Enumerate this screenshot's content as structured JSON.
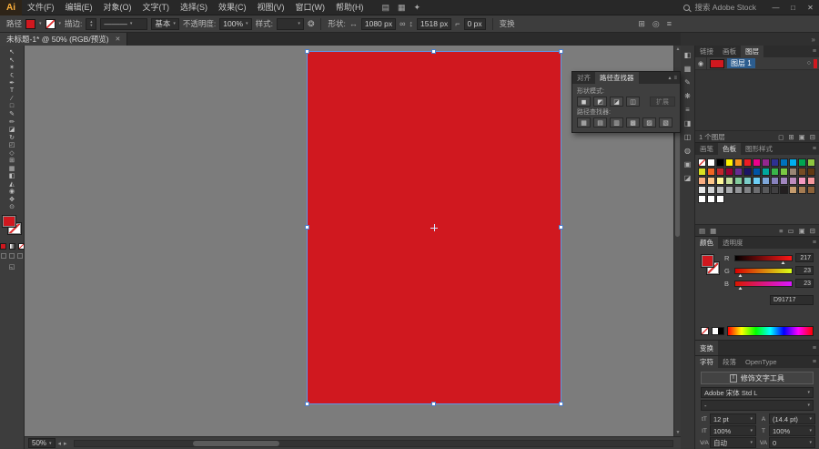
{
  "window": {
    "minimize": "—",
    "maximize": "□",
    "close": "✕"
  },
  "menubar": {
    "logo": "Ai",
    "items": [
      "文件(F)",
      "编辑(E)",
      "对象(O)",
      "文字(T)",
      "选择(S)",
      "效果(C)",
      "视图(V)",
      "窗口(W)",
      "帮助(H)"
    ],
    "app_icons": [
      {
        "name": "bridge-icon",
        "glyph": "▤"
      },
      {
        "name": "arrange-documents-icon",
        "glyph": "▦"
      },
      {
        "name": "workspace-switcher-icon",
        "glyph": "✦"
      }
    ],
    "search_label": "搜索 Adobe Stock"
  },
  "controlbar": {
    "object_label": "路径",
    "fill_color": "#d0181f",
    "stroke_label": "描边:",
    "profile_value": "———",
    "brush_value": "基本",
    "opacity_label": "不透明度:",
    "opacity_value": "100%",
    "style_label": "样式:",
    "recolor_glyph": "❂",
    "shape_label": "形状:",
    "w_value": "1080 px",
    "link_glyph": "∞",
    "h_value": "1518 px",
    "corner_value": "0 px",
    "transform_label": "变换",
    "right_icons": [
      {
        "name": "align-objects-icon",
        "glyph": "⊞"
      },
      {
        "name": "isolate-icon",
        "glyph": "◎"
      },
      {
        "name": "control-panel-menu-icon",
        "glyph": "≡"
      }
    ]
  },
  "doc_tab": {
    "title": "未标题-1* @ 50% (RGB/预览)",
    "close_glyph": "✕"
  },
  "toolbar": {
    "fill_color": "#d0181f",
    "tools": [
      {
        "name": "selection-tool",
        "glyph": "↖"
      },
      {
        "name": "direct-selection-tool",
        "glyph": "↖"
      },
      {
        "name": "magic-wand-tool",
        "glyph": "✶"
      },
      {
        "name": "lasso-tool",
        "glyph": "ς"
      },
      {
        "name": "pen-tool",
        "glyph": "✒"
      },
      {
        "name": "type-tool",
        "glyph": "T"
      },
      {
        "name": "line-segment-tool",
        "glyph": "∕"
      },
      {
        "name": "rectangle-tool",
        "glyph": "□"
      },
      {
        "name": "paintbrush-tool",
        "glyph": "✎"
      },
      {
        "name": "pencil-tool",
        "glyph": "✏"
      },
      {
        "name": "eraser-tool",
        "glyph": "◪"
      },
      {
        "name": "rotate-tool",
        "glyph": "↻"
      },
      {
        "name": "scale-tool",
        "glyph": "◰"
      },
      {
        "name": "width-tool",
        "glyph": "◇"
      },
      {
        "name": "shape-builder-tool",
        "glyph": "⊞"
      },
      {
        "name": "mesh-tool",
        "glyph": "▦"
      },
      {
        "name": "gradient-tool",
        "glyph": "◧"
      },
      {
        "name": "eyedropper-tool",
        "glyph": "◭"
      },
      {
        "name": "blend-tool",
        "glyph": "◉"
      },
      {
        "name": "hand-tool",
        "glyph": "✥"
      },
      {
        "name": "zoom-tool",
        "glyph": "⊙"
      }
    ]
  },
  "canvas": {
    "artboard_color": "#d0181f",
    "selection_color": "#5f96e8"
  },
  "pathfinder_panel": {
    "tabs": [
      "对齐",
      "路径查找器"
    ],
    "active_tab": "路径查找器",
    "shape_modes_label": "形状模式:",
    "shape_mode_icons": [
      {
        "name": "unite-icon",
        "glyph": "◼"
      },
      {
        "name": "minus-front-icon",
        "glyph": "◩"
      },
      {
        "name": "intersect-icon",
        "glyph": "◪"
      },
      {
        "name": "exclude-icon",
        "glyph": "◫"
      }
    ],
    "expand_label": "扩展",
    "pathfinders_label": "路径查找器:",
    "pathfinder_icons": [
      {
        "name": "divide-icon",
        "glyph": "▦"
      },
      {
        "name": "trim-icon",
        "glyph": "▤"
      },
      {
        "name": "merge-icon",
        "glyph": "▥"
      },
      {
        "name": "crop-icon",
        "glyph": "▩"
      },
      {
        "name": "outline-icon",
        "glyph": "▨"
      },
      {
        "name": "minus-back-icon",
        "glyph": "▧"
      }
    ]
  },
  "dock": {
    "collapse_glyph": "»",
    "strip_icons": [
      {
        "name": "color-panel-icon",
        "glyph": "◧"
      },
      {
        "name": "swatches-panel-icon",
        "glyph": "▦"
      },
      {
        "name": "brushes-panel-icon",
        "glyph": "✎"
      },
      {
        "name": "symbols-panel-icon",
        "glyph": "❋"
      },
      {
        "name": "stroke-panel-icon",
        "glyph": "≡"
      },
      {
        "name": "gradient-panel-icon",
        "glyph": "◨"
      },
      {
        "name": "transparency-panel-icon",
        "glyph": "◫"
      },
      {
        "name": "appearance-panel-icon",
        "glyph": "◍"
      },
      {
        "name": "graphic-styles-panel-icon",
        "glyph": "▣"
      },
      {
        "name": "pathfinder-panel-icon",
        "glyph": "◪"
      }
    ]
  },
  "layers_panel": {
    "tabs": [
      "链接",
      "画板",
      "图层"
    ],
    "active_tab": "图层",
    "eye_glyph": "◉",
    "layer_name": "图层 1",
    "target_glyph": "○",
    "footer_text": "1 个图层",
    "footer_icons": [
      {
        "name": "clipping-mask-icon",
        "glyph": "◻"
      },
      {
        "name": "new-sublayer-icon",
        "glyph": "⊞"
      },
      {
        "name": "new-layer-icon",
        "glyph": "▣"
      },
      {
        "name": "delete-layer-icon",
        "glyph": "⊟"
      }
    ]
  },
  "swatches_panel": {
    "tabs": [
      "画笔",
      "色板",
      "图形样式"
    ],
    "active_tab": "色板",
    "swatches": [
      "none",
      "#ffffff",
      "#000000",
      "#fff200",
      "#f7941d",
      "#ed1c24",
      "#ec008c",
      "#92278f",
      "#2e3192",
      "#0072bc",
      "#00aeef",
      "#00a651",
      "#8dc63f",
      "#d9e021",
      "#f26522",
      "#c1272d",
      "#990033",
      "#662d91",
      "#1b1464",
      "#0054a6",
      "#00a99d",
      "#39b54a",
      "#7ac943",
      "#998675",
      "#754c24",
      "#603913",
      "#f9ad81",
      "#fdc689",
      "#fff799",
      "#c4df9b",
      "#82ca9c",
      "#7accc8",
      "#6dcff6",
      "#7da7d9",
      "#8781bd",
      "#a186be",
      "#bd8cbf",
      "#f49ac1",
      "#f5989d",
      "#e6e7e8",
      "#d1d3d4",
      "#bcbec0",
      "#a7a9ac",
      "#939598",
      "#808285",
      "#6d6e71",
      "#58595b",
      "#414042",
      "#231f20",
      "#c69c6d",
      "#a67c52",
      "#8c6239",
      "#ffffff",
      "#ffffff",
      "#ffffff",
      "empty",
      "empty",
      "empty",
      "empty",
      "empty",
      "empty",
      "empty",
      "empty",
      "empty",
      "empty"
    ],
    "footer_left_icons": [
      {
        "name": "swatch-libraries-icon",
        "glyph": "▤"
      },
      {
        "name": "swatch-kinds-icon",
        "glyph": "▦"
      }
    ],
    "footer_right_icons": [
      {
        "name": "swatch-options-icon",
        "glyph": "≡"
      },
      {
        "name": "new-color-group-icon",
        "glyph": "▭"
      },
      {
        "name": "new-swatch-icon",
        "glyph": "▣"
      },
      {
        "name": "delete-swatch-icon",
        "glyph": "⊟"
      }
    ]
  },
  "color_panel": {
    "tabs": [
      "颜色",
      "透明度"
    ],
    "active_tab": "颜色",
    "channels": [
      {
        "label": "R",
        "value": "217",
        "gradient": "linear-gradient(90deg,#000000,#ff1717)",
        "tick": "85%"
      },
      {
        "label": "G",
        "value": "23",
        "gradient": "linear-gradient(90deg,#d90000,#d9ff17)",
        "tick": "9%"
      },
      {
        "label": "B",
        "value": "23",
        "gradient": "linear-gradient(90deg,#d91700,#d917ff)",
        "tick": "9%"
      }
    ],
    "hex_value": "D91717"
  },
  "transform_panel": {
    "title": "变换"
  },
  "character_panel": {
    "tabs": [
      "字符",
      "段落",
      "OpenType"
    ],
    "active_tab": "字符",
    "touch_type_label": "修饰文字工具",
    "touch_type_icon": "T",
    "font_family": "Adobe 宋体 Std L",
    "font_style": "-",
    "fields": [
      {
        "name": "font-size-field",
        "icon": "tT",
        "value": "12 pt"
      },
      {
        "name": "leading-field",
        "icon": "A",
        "value": "(14.4 pt)"
      },
      {
        "name": "vertical-scale-field",
        "icon": "IT",
        "value": "100%"
      },
      {
        "name": "horizontal-scale-field",
        "icon": "T",
        "value": "100%"
      },
      {
        "name": "kerning-field",
        "icon": "V⁄A",
        "value": "自动"
      },
      {
        "name": "tracking-field",
        "icon": "VA",
        "value": "0"
      }
    ]
  },
  "statusbar": {
    "zoom": "50%",
    "nav_prev": "◂",
    "nav_next": "▸"
  }
}
